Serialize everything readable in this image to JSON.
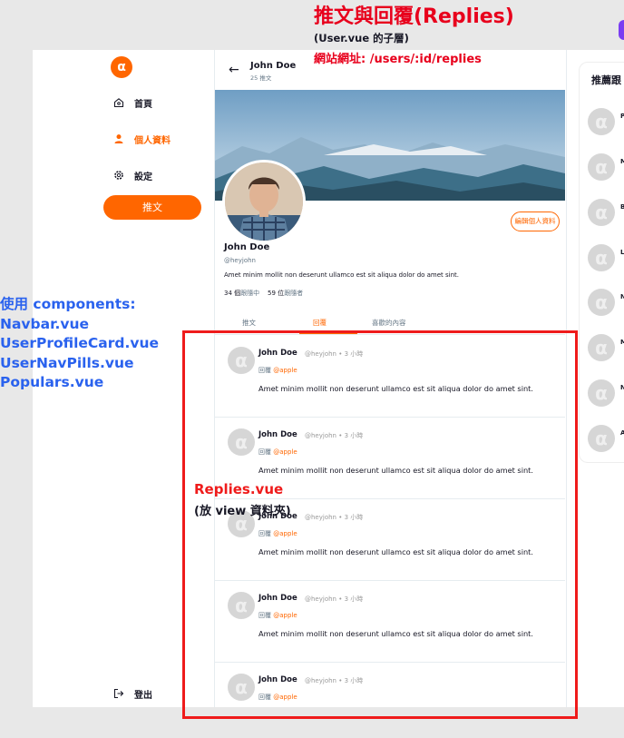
{
  "annotations": {
    "title": "推文與回覆(Replies)",
    "subtitle": "(User.vue 的子層)",
    "url": "網站網址: /users/:id/replies",
    "components": [
      "使用 components:",
      "Navbar.vue",
      "UserProfileCard.vue",
      "UserNavPills.vue",
      "Populars.vue"
    ],
    "replies_title": "Replies.vue",
    "replies_sub": "(放 view 資料夾)"
  },
  "navbar": {
    "logo_icon": "logo-icon",
    "items": [
      {
        "label": "首頁",
        "icon": "home-icon"
      },
      {
        "label": "個人資料",
        "icon": "user-icon"
      },
      {
        "label": "設定",
        "icon": "gear-icon"
      }
    ],
    "tweet_button": "推文",
    "logout": "登出"
  },
  "header": {
    "name": "John Doe",
    "count": "25 推文"
  },
  "profile": {
    "edit_button": "編輯個人資料",
    "name": "John Doe",
    "handle": "@heyjohn",
    "bio": "Amet minim mollit non deserunt ullamco est sit aliqua dolor do amet sint.",
    "following_count": "34 個",
    "following_label": "跟隨中",
    "followers_count": "59 位",
    "followers_label": "跟隨者"
  },
  "tabs": [
    {
      "label": "推文"
    },
    {
      "label": "回覆"
    },
    {
      "label": "喜歡的內容"
    }
  ],
  "replies": [
    {
      "name": "John Doe",
      "meta": "@heyjohn • 3 小時",
      "reply_label": "回覆",
      "reply_to": "@apple",
      "text": "Amet minim mollit non deserunt ullamco est sit aliqua dolor do amet sint."
    },
    {
      "name": "John Doe",
      "meta": "@heyjohn • 3 小時",
      "reply_label": "回覆",
      "reply_to": "@apple",
      "text": "Amet minim mollit non deserunt ullamco est sit aliqua dolor do amet sint."
    },
    {
      "name": "John Doe",
      "meta": "@heyjohn • 3 小時",
      "reply_label": "回覆",
      "reply_to": "@apple",
      "text": "Amet minim mollit non deserunt ullamco est sit aliqua dolor do amet sint."
    },
    {
      "name": "John Doe",
      "meta": "@heyjohn • 3 小時",
      "reply_label": "回覆",
      "reply_to": "@apple",
      "text": "Amet minim mollit non deserunt ullamco est sit aliqua dolor do amet sint."
    },
    {
      "name": "John Doe",
      "meta": "@heyjohn • 3 小時",
      "reply_label": "回覆",
      "reply_to": "@apple",
      "text": ""
    }
  ],
  "popular": {
    "title": "推薦跟",
    "letters": [
      "P",
      "M",
      "B",
      "L",
      "N",
      "M",
      "N",
      "A"
    ]
  },
  "colors": {
    "accent": "#ff6600",
    "annotation_red": "#e8001c",
    "annotation_blue": "#2a62ee"
  }
}
